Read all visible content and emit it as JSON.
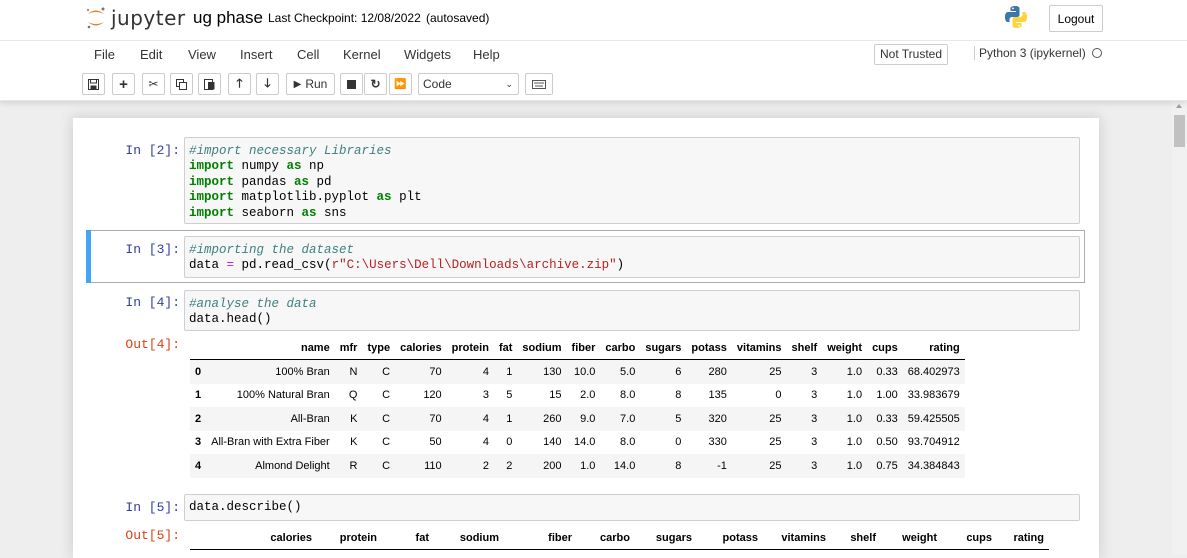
{
  "header": {
    "logo_text": "jupyter",
    "notebook_name": "ug phase",
    "checkpoint": "Last Checkpoint: 12/08/2022",
    "autosave_status": "(autosaved)",
    "logout_label": "Logout"
  },
  "menu": [
    "File",
    "Edit",
    "View",
    "Insert",
    "Cell",
    "Kernel",
    "Widgets",
    "Help"
  ],
  "trust_status": "Not Trusted",
  "kernel_name": "Python 3 (ipykernel)",
  "toolbar": {
    "run_label": "Run",
    "cell_type": "Code"
  },
  "cells": [
    {
      "prompt": "In [2]:",
      "lines": [
        [
          {
            "t": "#import necessary Libraries",
            "c": "cm"
          }
        ],
        [
          {
            "t": "import",
            "c": "kw"
          },
          {
            "t": " numpy "
          },
          {
            "t": "as",
            "c": "kw"
          },
          {
            "t": " np"
          }
        ],
        [
          {
            "t": "import",
            "c": "kw"
          },
          {
            "t": " pandas "
          },
          {
            "t": "as",
            "c": "kw"
          },
          {
            "t": " pd"
          }
        ],
        [
          {
            "t": "import",
            "c": "kw"
          },
          {
            "t": " matplotlib.pyplot "
          },
          {
            "t": "as",
            "c": "kw"
          },
          {
            "t": " plt"
          }
        ],
        [
          {
            "t": "import",
            "c": "kw"
          },
          {
            "t": " seaborn "
          },
          {
            "t": "as",
            "c": "kw"
          },
          {
            "t": " sns"
          }
        ]
      ]
    },
    {
      "prompt": "In [3]:",
      "lines": [
        [
          {
            "t": "#importing the dataset",
            "c": "cm"
          }
        ],
        [
          {
            "t": "data "
          },
          {
            "t": "=",
            "c": "op"
          },
          {
            "t": " pd.read_csv("
          },
          {
            "t": "r\"C:\\Users\\Dell\\Downloads\\archive.zip\"",
            "c": "st"
          },
          {
            "t": ")"
          }
        ]
      ]
    },
    {
      "prompt": "In [4]:",
      "lines": [
        [
          {
            "t": "#analyse the data",
            "c": "cm"
          }
        ],
        [
          {
            "t": "data.head()"
          }
        ]
      ]
    },
    {
      "prompt": "In [5]:",
      "lines": [
        [
          {
            "t": "data.describe()"
          }
        ]
      ]
    }
  ],
  "outputs": {
    "out4_prompt": "Out[4]:",
    "out5_prompt": "Out[5]:",
    "head_table": {
      "columns": [
        "",
        "name",
        "mfr",
        "type",
        "calories",
        "protein",
        "fat",
        "sodium",
        "fiber",
        "carbo",
        "sugars",
        "potass",
        "vitamins",
        "shelf",
        "weight",
        "cups",
        "rating"
      ],
      "rows": [
        [
          "0",
          "100% Bran",
          "N",
          "C",
          "70",
          "4",
          "1",
          "130",
          "10.0",
          "5.0",
          "6",
          "280",
          "25",
          "3",
          "1.0",
          "0.33",
          "68.402973"
        ],
        [
          "1",
          "100% Natural Bran",
          "Q",
          "C",
          "120",
          "3",
          "5",
          "15",
          "2.0",
          "8.0",
          "8",
          "135",
          "0",
          "3",
          "1.0",
          "1.00",
          "33.983679"
        ],
        [
          "2",
          "All-Bran",
          "K",
          "C",
          "70",
          "4",
          "1",
          "260",
          "9.0",
          "7.0",
          "5",
          "320",
          "25",
          "3",
          "1.0",
          "0.33",
          "59.425505"
        ],
        [
          "3",
          "All-Bran with Extra Fiber",
          "K",
          "C",
          "50",
          "4",
          "0",
          "140",
          "14.0",
          "8.0",
          "0",
          "330",
          "25",
          "3",
          "1.0",
          "0.50",
          "93.704912"
        ],
        [
          "4",
          "Almond Delight",
          "R",
          "C",
          "110",
          "2",
          "2",
          "200",
          "1.0",
          "14.0",
          "8",
          "-1",
          "25",
          "3",
          "1.0",
          "0.75",
          "34.384843"
        ]
      ]
    },
    "describe_table": {
      "columns": [
        "",
        "calories",
        "protein",
        "fat",
        "sodium",
        "fiber",
        "carbo",
        "sugars",
        "potass",
        "vitamins",
        "shelf",
        "weight",
        "cups",
        "rating"
      ]
    }
  }
}
